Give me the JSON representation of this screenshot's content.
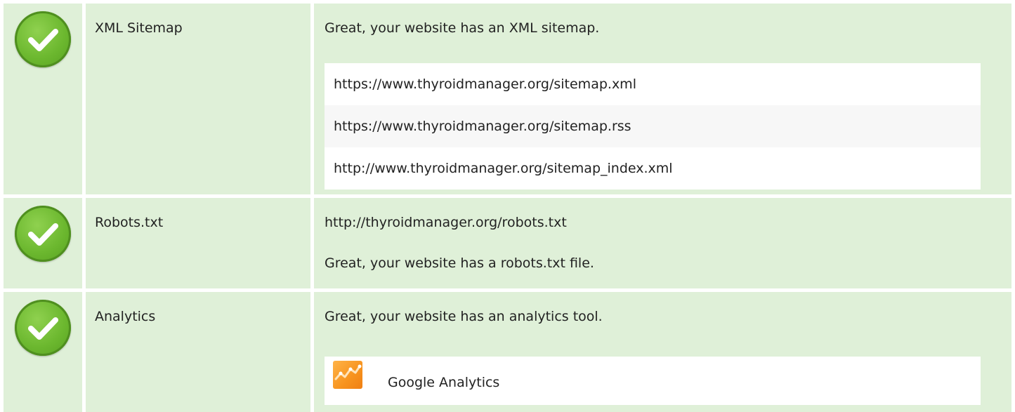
{
  "rows": [
    {
      "label": "XML Sitemap",
      "message": "Great, your website has an XML sitemap.",
      "urls": [
        "https://www.thyroidmanager.org/sitemap.xml",
        "https://www.thyroidmanager.org/sitemap.rss",
        "http://www.thyroidmanager.org/sitemap_index.xml"
      ],
      "status_icon": "check-circle-icon"
    },
    {
      "label": "Robots.txt",
      "url": "http://thyroidmanager.org/robots.txt",
      "message": "Great, your website has a robots.txt file.",
      "status_icon": "check-circle-icon"
    },
    {
      "label": "Analytics",
      "message": "Great, your website has an analytics tool.",
      "tool": {
        "name": "Google Analytics",
        "icon": "google-analytics-icon"
      },
      "status_icon": "check-circle-icon"
    }
  ],
  "colors": {
    "row_background": "#dff0d8",
    "check_green": "#6cb82f",
    "ga_orange": "#f7931e"
  }
}
